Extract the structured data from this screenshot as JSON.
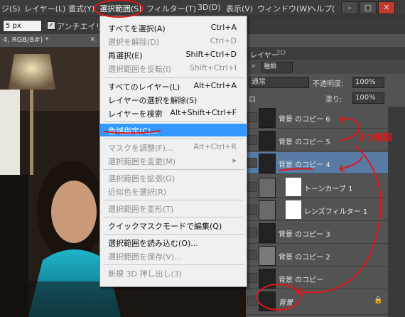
{
  "menubar": {
    "items": [
      "ジ(S)",
      "レイヤー(L)",
      "書式(Y)",
      "選択範囲(S)",
      "フィルター(T)",
      "3D(D)",
      "表示(V)",
      "ウィンドウ(W)",
      "ヘルプ("
    ],
    "win_minimize": "–",
    "win_maximize": "□",
    "win_close": "✕"
  },
  "options": {
    "feather_value": "5 px",
    "antialias_label": "アンチエイリア"
  },
  "document": {
    "tab_label": "4, RGB/8#) *",
    "tab_close": "×"
  },
  "menu": {
    "items": [
      {
        "label": "すべてを選択(A)",
        "shortcut": "Ctrl+A",
        "disabled": false
      },
      {
        "label": "選択を解除(D)",
        "shortcut": "Ctrl+D",
        "disabled": true
      },
      {
        "label": "再選択(E)",
        "shortcut": "Shift+Ctrl+D",
        "disabled": false
      },
      {
        "label": "選択範囲を反転(I)",
        "shortcut": "Shift+Ctrl+I",
        "disabled": true
      },
      {
        "label": "すべてのレイヤー(L)",
        "shortcut": "Alt+Ctrl+A",
        "disabled": false
      },
      {
        "label": "レイヤーの選択を解除(S)",
        "shortcut": "",
        "disabled": false
      },
      {
        "label": "レイヤーを検索",
        "shortcut": "Alt+Shift+Ctrl+F",
        "disabled": false
      },
      {
        "label": "色域指定(C)...",
        "shortcut": "",
        "disabled": false,
        "highlighted": true
      },
      {
        "label": "マスクを調整(F)...",
        "shortcut": "Alt+Ctrl+R",
        "disabled": true
      },
      {
        "label": "選択範囲を変更(M)",
        "shortcut": "▸",
        "disabled": true
      },
      {
        "label": "選択範囲を拡張(G)",
        "shortcut": "",
        "disabled": true
      },
      {
        "label": "近似色を選択(R)",
        "shortcut": "",
        "disabled": true
      },
      {
        "label": "選択範囲を変形(T)",
        "shortcut": "",
        "disabled": true
      },
      {
        "label": "クイックマスクモードで編集(Q)",
        "shortcut": "",
        "disabled": false
      },
      {
        "label": "選択範囲を読み込む(O)...",
        "shortcut": "",
        "disabled": false
      },
      {
        "label": "選択範囲を保存(V)...",
        "shortcut": "",
        "disabled": true
      },
      {
        "label": "新規 3D 押し出し(3)",
        "shortcut": "",
        "disabled": true
      }
    ]
  },
  "panel": {
    "tabs": [
      "レイヤー",
      "3D"
    ],
    "filter_label": "種類",
    "blend_mode": "通常",
    "opacity_label": "不透明度:",
    "opacity_value": "100%",
    "fill_label": "塗り:",
    "fill_value": "100%",
    "lock_label": "ロ"
  },
  "layers": [
    {
      "name": "背景 のコピー 6",
      "selected": false
    },
    {
      "name": "背景 のコピー 5",
      "selected": false
    },
    {
      "name": "背景 のコピー 4",
      "selected": true
    },
    {
      "name": "トーンカーブ 1",
      "selected": false
    },
    {
      "name": "レンズフィルター 1",
      "selected": false
    },
    {
      "name": "背景 のコピー 3",
      "selected": false
    },
    {
      "name": "背景 のコピー 2",
      "selected": false
    },
    {
      "name": "背景 のコピー",
      "selected": false
    },
    {
      "name": "背景",
      "selected": false
    }
  ],
  "annotation": {
    "text": "3つ複製",
    "color": "#e0161a"
  }
}
